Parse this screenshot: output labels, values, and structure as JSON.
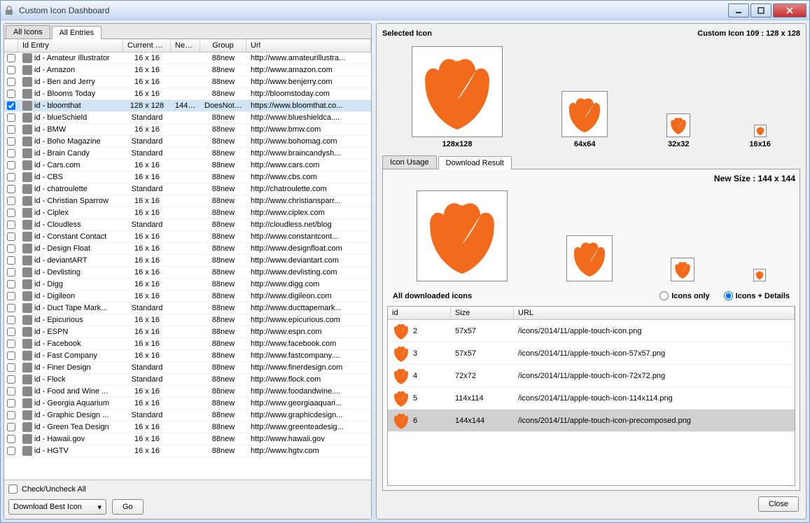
{
  "window": {
    "title": "Custom Icon Dashboard"
  },
  "left": {
    "tabs": [
      "All Icons",
      "All Entries"
    ],
    "active_tab": 1,
    "columns": {
      "entry": "Id Entry",
      "size": "Current Size",
      "new": "New...",
      "group": "Group",
      "url": "Url"
    },
    "rows": [
      {
        "entry": "id - Amateur Illustrator",
        "size": "16 x 16",
        "new": "",
        "group": "88new",
        "url": "http://www.amateurillustra..."
      },
      {
        "entry": "id - Amazon",
        "size": "16 x 16",
        "new": "",
        "group": "88new",
        "url": "http://www.amazon.com"
      },
      {
        "entry": "id - Ben and Jerry",
        "size": "16 x 16",
        "new": "",
        "group": "88new",
        "url": "http://www.benjerry.com"
      },
      {
        "entry": "id - Blooms Today",
        "size": "16 x 16",
        "new": "",
        "group": "88new",
        "url": "http://bloomstoday.com"
      },
      {
        "entry": "id - bloomthat",
        "size": "128 x 128",
        "new": "144 ...",
        "group": "DoesNotW...",
        "url": "https://www.bloomthat.co...",
        "checked": true,
        "selected": true
      },
      {
        "entry": "id - blueSchield",
        "size": "Standard",
        "new": "",
        "group": "88new",
        "url": "http://www.blueshieldca...."
      },
      {
        "entry": "id - BMW",
        "size": "16 x 16",
        "new": "",
        "group": "88new",
        "url": "http://www.bmw.com"
      },
      {
        "entry": "id - Boho Magazine",
        "size": "Standard",
        "new": "",
        "group": "88new",
        "url": "http://www.bohomag.com"
      },
      {
        "entry": "id - Brain Candy",
        "size": "Standard",
        "new": "",
        "group": "88new",
        "url": "http://www.braincandysh..."
      },
      {
        "entry": "id - Cars.com",
        "size": "16 x 16",
        "new": "",
        "group": "88new",
        "url": "http://www.cars.com"
      },
      {
        "entry": "id - CBS",
        "size": "16 x 16",
        "new": "",
        "group": "88new",
        "url": "http://www.cbs.com"
      },
      {
        "entry": "id - chatroulette",
        "size": "Standard",
        "new": "",
        "group": "88new",
        "url": "http://chatroulette.com"
      },
      {
        "entry": "id - Christian Sparrow",
        "size": "16 x 16",
        "new": "",
        "group": "88new",
        "url": "http://www.christiansparr..."
      },
      {
        "entry": "id - Ciplex",
        "size": "16 x 16",
        "new": "",
        "group": "88new",
        "url": "http://www.ciplex.com"
      },
      {
        "entry": "id - Cloudless",
        "size": "Standard",
        "new": "",
        "group": "88new",
        "url": "http://cloudless.net/blog"
      },
      {
        "entry": "id - Constant Contact",
        "size": "16 x 16",
        "new": "",
        "group": "88new",
        "url": "http://www.constantcont..."
      },
      {
        "entry": "id - Design Float",
        "size": "16 x 16",
        "new": "",
        "group": "88new",
        "url": "http://www.designfloat.com"
      },
      {
        "entry": "id - deviantART",
        "size": "16 x 16",
        "new": "",
        "group": "88new",
        "url": "http://www.deviantart.com"
      },
      {
        "entry": "id - Devlisting",
        "size": "16 x 16",
        "new": "",
        "group": "88new",
        "url": "http://www.devlisting.com"
      },
      {
        "entry": "id - Digg",
        "size": "16 x 16",
        "new": "",
        "group": "88new",
        "url": "http://www.digg.com"
      },
      {
        "entry": "id - Digileon",
        "size": "16 x 16",
        "new": "",
        "group": "88new",
        "url": "http://www.digileon.com"
      },
      {
        "entry": "id - Duct Tape Mark...",
        "size": "Standard",
        "new": "",
        "group": "88new",
        "url": "http://www.ducttapemark..."
      },
      {
        "entry": "id - Epicurious",
        "size": "16 x 16",
        "new": "",
        "group": "88new",
        "url": "http://www.epicurious.com"
      },
      {
        "entry": "id - ESPN",
        "size": "16 x 16",
        "new": "",
        "group": "88new",
        "url": "http://www.espn.com"
      },
      {
        "entry": "id - Facebook",
        "size": "16 x 16",
        "new": "",
        "group": "88new",
        "url": "http://www.facebook.com"
      },
      {
        "entry": "id - Fast Company",
        "size": "16 x 16",
        "new": "",
        "group": "88new",
        "url": "http://www.fastcompany...."
      },
      {
        "entry": "id - Finer Design",
        "size": "Standard",
        "new": "",
        "group": "88new",
        "url": "http://www.finerdesign.com"
      },
      {
        "entry": "id - Flock",
        "size": "Standard",
        "new": "",
        "group": "88new",
        "url": "http://www.flock.com"
      },
      {
        "entry": "id - Food and Wine ...",
        "size": "16 x 16",
        "new": "",
        "group": "88new",
        "url": "http://www.foodandwine...."
      },
      {
        "entry": "id - Georgia Aquarium",
        "size": "16 x 16",
        "new": "",
        "group": "88new",
        "url": "http://www.georgiaaquari..."
      },
      {
        "entry": "id - Graphic Design ...",
        "size": "Standard",
        "new": "",
        "group": "88new",
        "url": "http://www.graphicdesign..."
      },
      {
        "entry": "id - Green Tea Design",
        "size": "16 x 16",
        "new": "",
        "group": "88new",
        "url": "http://www.greenteadesig..."
      },
      {
        "entry": "id - Hawaii.gov",
        "size": "16 x 16",
        "new": "",
        "group": "88new",
        "url": "http://www.hawaii.gov"
      },
      {
        "entry": "id - HGTV",
        "size": "16 x 16",
        "new": "",
        "group": "88new",
        "url": "http://www.hgtv.com"
      }
    ],
    "footer": {
      "check_all": "Check/Uncheck All",
      "dropdown": "Download Best Icon",
      "go": "Go"
    }
  },
  "right": {
    "selected_label": "Selected Icon",
    "custom_label": "Custom Icon 109 : 128 x 128",
    "previews": [
      "128x128",
      "64x64",
      "32x32",
      "16x16"
    ],
    "sub_tabs": [
      "Icon Usage",
      "Download Result"
    ],
    "active_sub_tab": 1,
    "new_size": "New Size : 144 x 144",
    "dl_title": "All downloaded icons",
    "radio": {
      "icons_only": "Icons only",
      "icons_details": "Icons + Details"
    },
    "dl_columns": {
      "id": "id",
      "size": "Size",
      "url": "URL"
    },
    "dl_rows": [
      {
        "id": "2",
        "size": "57x57",
        "url": "/icons/2014/11/apple-touch-icon.png"
      },
      {
        "id": "3",
        "size": "57x57",
        "url": "/icons/2014/11/apple-touch-icon-57x57.png"
      },
      {
        "id": "4",
        "size": "72x72",
        "url": "/icons/2014/11/apple-touch-icon-72x72.png"
      },
      {
        "id": "5",
        "size": "114x114",
        "url": "/icons/2014/11/apple-touch-icon-114x114.png"
      },
      {
        "id": "6",
        "size": "144x144",
        "url": "/icons/2014/11/apple-touch-icon-precomposed.png",
        "selected": true
      }
    ],
    "close": "Close"
  }
}
